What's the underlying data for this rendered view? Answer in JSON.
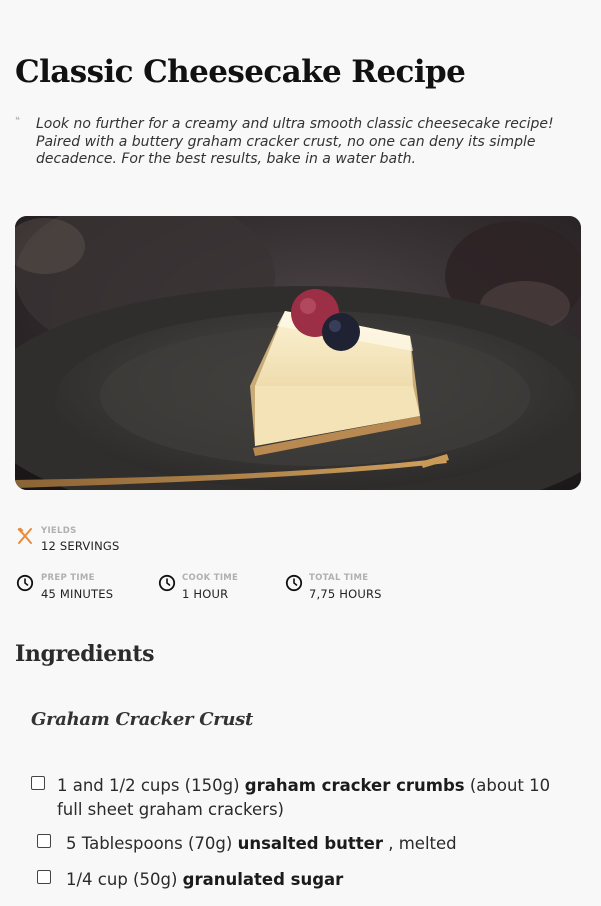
{
  "recipe": {
    "title": "Classic Cheesecake Recipe",
    "intro_mark": "❝",
    "intro": "Look no further for a creamy and ultra smooth classic cheesecake recipe! Paired with a buttery graham cracker crust, no one can deny its simple decadence. For the best results, bake in a water bath."
  },
  "meta": {
    "yields": {
      "label": "YIELDS",
      "value": "12 SERVINGS",
      "icon": "utensils-icon",
      "color": "#e8893d"
    },
    "prep": {
      "label": "PREP TIME",
      "value": "45 MINUTES",
      "icon": "clock-icon"
    },
    "cook": {
      "label": "COOK TIME",
      "value": "1 HOUR",
      "icon": "clock-icon"
    },
    "total": {
      "label": "TOTAL TIME",
      "value": "7,75 HOURS",
      "icon": "clock-icon"
    }
  },
  "ingredients": {
    "title": "Ingredients",
    "groups": [
      {
        "title": "Graham Cracker Crust",
        "items": [
          {
            "amount": "1 and 1/2 cups (150g)",
            "name": "graham cracker crumbs",
            "note": "(about 10",
            "note2": "full sheet graham crackers)"
          },
          {
            "amount": "5 Tablespoons (70g)",
            "name": "unsalted butter",
            "note": ", melted"
          },
          {
            "amount": "1/4 cup (50g)",
            "name": "granulated sugar",
            "note": ""
          }
        ]
      }
    ]
  }
}
